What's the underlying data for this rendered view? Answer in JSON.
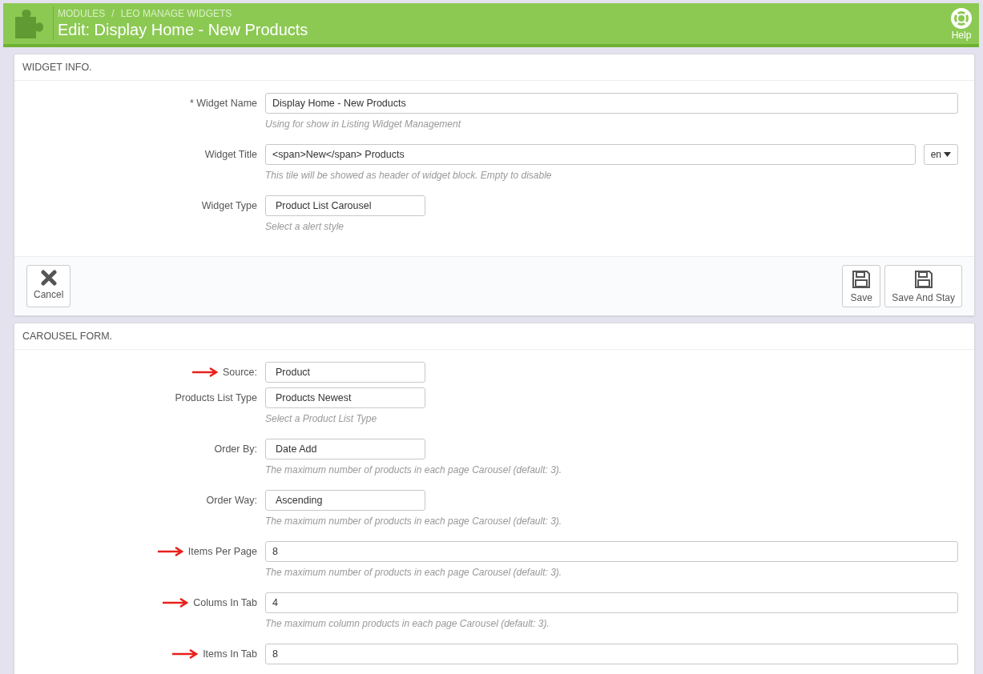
{
  "header": {
    "breadcrumb": [
      "MODULES",
      "LEO MANAGE WIDGETS"
    ],
    "separator": "/",
    "title": "Edit: Display Home - New Products",
    "help": "Help"
  },
  "panels": [
    {
      "title": "WIDGET INFO.",
      "fields": [
        {
          "label": "* Widget Name",
          "value": "Display Home - New Products",
          "kind": "text",
          "hint": "Using for show in Listing Widget Management",
          "marked": false
        },
        {
          "label": "Widget Title",
          "value": "<span>New</span> Products",
          "kind": "text",
          "lang": "en",
          "hint": "This tile will be showed as header of widget block. Empty to disable",
          "marked": false
        },
        {
          "label": "Widget Type",
          "value": "Product List Carousel",
          "kind": "select",
          "hint": "Select a alert style",
          "marked": false
        }
      ],
      "footer": {
        "left": [
          {
            "label": "Cancel",
            "kind": "cancel"
          }
        ],
        "right": [
          {
            "label": "Save",
            "kind": "save"
          },
          {
            "label": "Save And Stay",
            "kind": "save"
          }
        ]
      }
    },
    {
      "title": "CAROUSEL FORM.",
      "fields": [
        {
          "label": "Source:",
          "value": "Product",
          "kind": "select",
          "marked": true
        },
        {
          "label": "Products List Type",
          "value": "Products Newest",
          "kind": "select",
          "hint": "Select a Product List Type",
          "marked": false
        },
        {
          "label": "Order By:",
          "value": "Date Add",
          "kind": "select",
          "hint": "The maximum number of products in each page Carousel (default: 3).",
          "marked": false
        },
        {
          "label": "Order Way:",
          "value": "Ascending",
          "kind": "select",
          "hint": "The maximum number of products in each page Carousel (default: 3).",
          "marked": false
        },
        {
          "label": "Items Per Page",
          "value": "8",
          "kind": "text",
          "hint": "The maximum number of products in each page Carousel (default: 3).",
          "marked": true
        },
        {
          "label": "Colums In Tab",
          "value": "4",
          "kind": "text",
          "hint": "The maximum column products in each page Carousel (default: 3).",
          "marked": true
        },
        {
          "label": "Items In Tab",
          "value": "8",
          "kind": "text",
          "marked": true
        }
      ]
    }
  ]
}
